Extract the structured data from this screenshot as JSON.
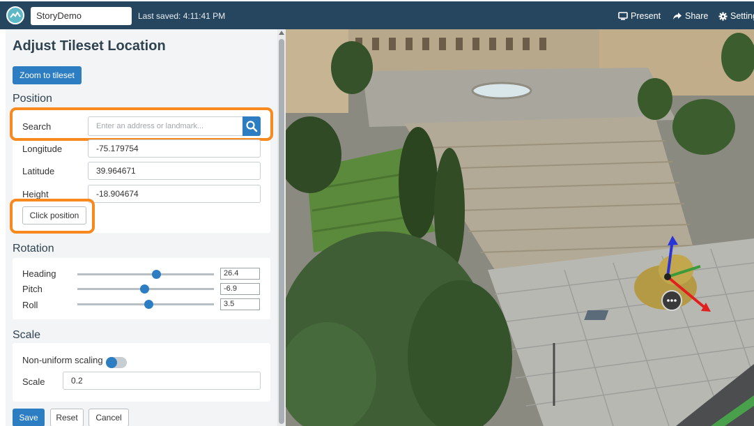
{
  "topbar": {
    "story_name": "StoryDemo",
    "last_saved": "Last saved: 4:11:41 PM",
    "present_label": "Present",
    "share_label": "Share",
    "settings_label": "Settings",
    "background_color": "#26455f"
  },
  "panel": {
    "title": "Adjust Tileset Location",
    "zoom_button_label": "Zoom to tileset",
    "position": {
      "section_label": "Position",
      "search_label": "Search",
      "search_placeholder": "Enter an address or landmark...",
      "longitude_label": "Longitude",
      "longitude_value": "-75.179754",
      "latitude_label": "Latitude",
      "latitude_value": "39.964671",
      "height_label": "Height",
      "height_value": "-18.904674",
      "click_position_label": "Click position"
    },
    "rotation": {
      "section_label": "Rotation",
      "heading_label": "Heading",
      "heading_value": "26.4",
      "pitch_label": "Pitch",
      "pitch_value": "-6.9",
      "roll_label": "Roll",
      "roll_value": "3.5"
    },
    "scale": {
      "section_label": "Scale",
      "non_uniform_label": "Non-uniform scaling",
      "non_uniform_enabled": false,
      "scale_label": "Scale",
      "scale_value": "0.2"
    },
    "actions": {
      "save_label": "Save",
      "reset_label": "Reset",
      "cancel_label": "Cancel"
    }
  },
  "colors": {
    "accent_blue": "#2d7dc2",
    "highlight_orange": "#f7891f"
  },
  "icons": {
    "logo": "app-logo-icon",
    "present": "monitor-icon",
    "share": "share-arrow-icon",
    "settings": "gear-icon",
    "search": "search-icon",
    "more": "ellipsis-icon"
  }
}
